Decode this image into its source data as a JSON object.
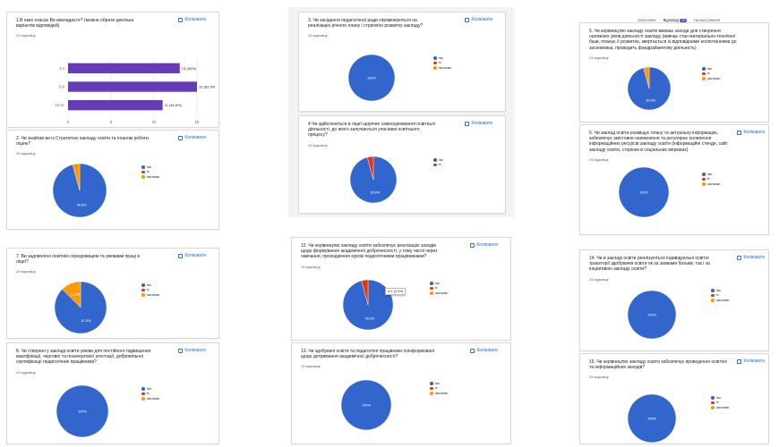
{
  "common": {
    "copy_label": "Копіювати",
    "legend": [
      "так",
      "ні",
      "частково"
    ],
    "colors": [
      "#3366cc",
      "#dc3912",
      "#ff9900"
    ]
  },
  "tabs": {
    "questions": "Запитання",
    "responses": "Відповіді",
    "responses_badge": "24",
    "settings": "Налаштування"
  },
  "q1": {
    "title": "1.В яких класах Ви викладаєте? (можна обрати декілька варіантів відповідей)",
    "count": "24 відповіді"
  },
  "q2": {
    "title": "2. Чи знайомі ви із Стратегією закладу освіти та планом роботи ліцею?",
    "count": "24 відповіді",
    "slice_label": "95.8%"
  },
  "q3": {
    "title": "3. Чи засідання педагогічної ради спрямовуються на реалізацію річного плану і стратегію розвитку закладу?",
    "count": "24 відповіді",
    "slice_label": "100%"
  },
  "q4": {
    "title": "4 Чи здійснюються в ліцеї щорічне самооцінювання освітньої діяльності, до якого залучаються учасники освітнього процесу?",
    "count": "24 відповіді",
    "slice_label": "95.8%"
  },
  "q5": {
    "title": "5. Чи керівництво закладу освіти вживає заходи для створення належних умов діяльності закладу (вивчає стан матеріально-технічної бази, планує її розвиток, звертається із відповідними клопотаннями до засновника, проводить фандрайзингову діяльність)",
    "count": "24 відповіді",
    "slice_label": "95.8%"
  },
  "q6": {
    "title": "6. Чи заклад освіти розміщує плану та актуальну інформацію, забезпечує змістовне наповнення та регулярне оновлення інформаційних ресурсів закладу освіти (інформаційні стенди, сайт закладу освіти, сторінки в соціальних мережах)",
    "count": "24 відповіді",
    "slice_label": "100%"
  },
  "q7": {
    "title": "7. Ви задоволені освітнім середовищем та умовами праці в ліцеї?",
    "count": "24 відповіді",
    "slice_labels": [
      "87.5%",
      "12.5%"
    ]
  },
  "q8": {
    "title": "8. Чи створені у закладі освіти умови для постійного підвищення кваліфікації, чергової та позачергової атестації, добровільної сертифікації педагогічних працівників?",
    "count": "24 відповіді",
    "slice_label": "100%"
  },
  "q12": {
    "title": "12. Чи керівництво закладу освіти забезпечує реалізацію заходів щодо формування академічної доброчесності, у тому числі через навчання, проходження курсів педагогічними працівниками?",
    "count": "24 відповіді",
    "slice_label": "95.8%",
    "tooltip": "ні 1 (4.2%)"
  },
  "q13": {
    "title": "13. Чи здобувачі освіти та педагогічні працівники поінформовані щодо дотримання академічної доброчесності?",
    "count": "24 відповіді",
    "slice_label": "100%"
  },
  "q14": {
    "title": "14. Чи в закладі освіти реалізуються індивідуальні освітні траєкторії здобувачів освіти як за заявами батьків, так і за ініціативою закладу освіти?",
    "count": "24 відповіді",
    "slice_label": "100%"
  },
  "q15": {
    "title": "15. Чи керівництво закладу освіти забезпечує проведення освітніх та інформаційних заходів?",
    "count": "24 відповіді",
    "slice_label": "100%"
  },
  "chart_data": [
    {
      "id": "q1",
      "type": "bar",
      "orientation": "horizontal",
      "categories": [
        "1-4",
        "5-9",
        "10-11"
      ],
      "values": [
        13,
        15,
        11
      ],
      "data_labels": [
        "13 (54%)",
        "15 (62.5%)",
        "11 (45.8%)"
      ],
      "xlim": [
        0,
        15
      ],
      "xticks": [
        0,
        5,
        10,
        15
      ],
      "color": "#673ab7",
      "grid": true
    },
    {
      "id": "q2",
      "type": "pie",
      "categories": [
        "так",
        "ні",
        "частково"
      ],
      "values": [
        95.8,
        0,
        4.2
      ]
    },
    {
      "id": "q3",
      "type": "pie",
      "categories": [
        "так",
        "ні",
        "частково"
      ],
      "values": [
        100,
        0,
        0
      ]
    },
    {
      "id": "q4",
      "type": "pie",
      "categories": [
        "так",
        "ні"
      ],
      "values": [
        95.8,
        4.2
      ]
    },
    {
      "id": "q5",
      "type": "pie",
      "categories": [
        "так",
        "ні",
        "частково"
      ],
      "values": [
        95.8,
        0,
        4.2
      ]
    },
    {
      "id": "q6",
      "type": "pie",
      "categories": [
        "так",
        "ні",
        "частково"
      ],
      "values": [
        100,
        0,
        0
      ]
    },
    {
      "id": "q7",
      "type": "pie",
      "categories": [
        "так",
        "ні",
        "частково"
      ],
      "values": [
        87.5,
        0,
        12.5
      ]
    },
    {
      "id": "q8",
      "type": "pie",
      "categories": [
        "так",
        "ні",
        "частково"
      ],
      "values": [
        100,
        0,
        0
      ]
    },
    {
      "id": "q12",
      "type": "pie",
      "categories": [
        "так",
        "ні",
        "частково"
      ],
      "values": [
        95.8,
        4.2,
        0
      ]
    },
    {
      "id": "q13",
      "type": "pie",
      "categories": [
        "так",
        "ні",
        "частково"
      ],
      "values": [
        100,
        0,
        0
      ]
    },
    {
      "id": "q14",
      "type": "pie",
      "categories": [
        "так",
        "ні",
        "частково"
      ],
      "values": [
        100,
        0,
        0
      ]
    },
    {
      "id": "q15",
      "type": "pie",
      "categories": [
        "так",
        "ні",
        "частково"
      ],
      "values": [
        100,
        0,
        0
      ]
    }
  ]
}
